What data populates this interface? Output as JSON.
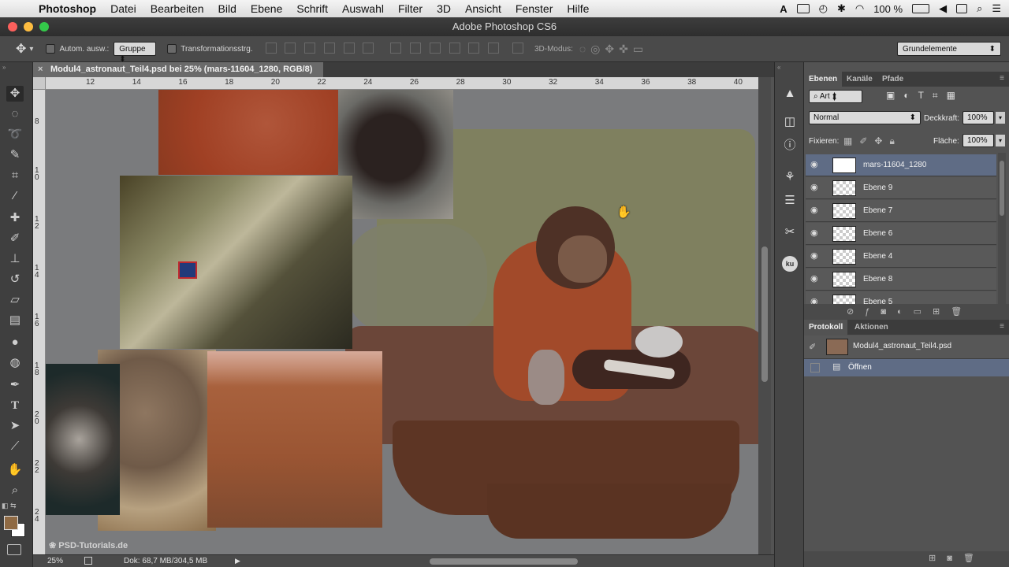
{
  "menubar": {
    "app": "Photoshop",
    "items": [
      "Datei",
      "Bearbeiten",
      "Bild",
      "Ebene",
      "Schrift",
      "Auswahl",
      "Filter",
      "3D",
      "Ansicht",
      "Fenster",
      "Hilfe"
    ],
    "battery": "100 %"
  },
  "window": {
    "title": "Adobe Photoshop CS6"
  },
  "options": {
    "auto_select_label": "Autom. ausw.:",
    "auto_select_value": "Gruppe",
    "transform_label": "Transformationsstrg.",
    "mode3d_label": "3D-Modus:",
    "workspace": "Grundelemente"
  },
  "document": {
    "tab_label": "Modul4_astronaut_Teil4.psd bei 25% (mars-11604_1280, RGB/8)",
    "ruler_top": [
      "12",
      "14",
      "16",
      "18",
      "20",
      "22",
      "24",
      "26",
      "28",
      "30",
      "32",
      "34",
      "36",
      "38",
      "40"
    ],
    "ruler_left": [
      "8",
      "1 0",
      "1 2",
      "1 4",
      "1 6",
      "1 8",
      "2 0",
      "2 2",
      "2 4"
    ]
  },
  "status": {
    "zoom": "25%",
    "doc": "Dok: 68,7 MB/304,5 MB"
  },
  "watermark": "PSD-Tutorials.de",
  "layers_panel": {
    "tabs": [
      "Ebenen",
      "Kanäle",
      "Pfade"
    ],
    "filter": "Art",
    "blend_mode": "Normal",
    "opacity_label": "Deckkraft:",
    "opacity": "100%",
    "lock_label": "Fixieren:",
    "fill_label": "Fläche:",
    "fill": "100%",
    "layers": [
      "mars-11604_1280",
      "Ebene 9",
      "Ebene 7",
      "Ebene 6",
      "Ebene 4",
      "Ebene 8",
      "Ebene 5"
    ]
  },
  "history_panel": {
    "tabs": [
      "Protokoll",
      "Aktionen"
    ],
    "snapshot": "Modul4_astronaut_Teil4.psd",
    "items": [
      "Öffnen"
    ]
  },
  "colors": {
    "selection": "#5f6c85",
    "panel_bg": "#535353",
    "canvas_bg": "#7a7b7d"
  }
}
